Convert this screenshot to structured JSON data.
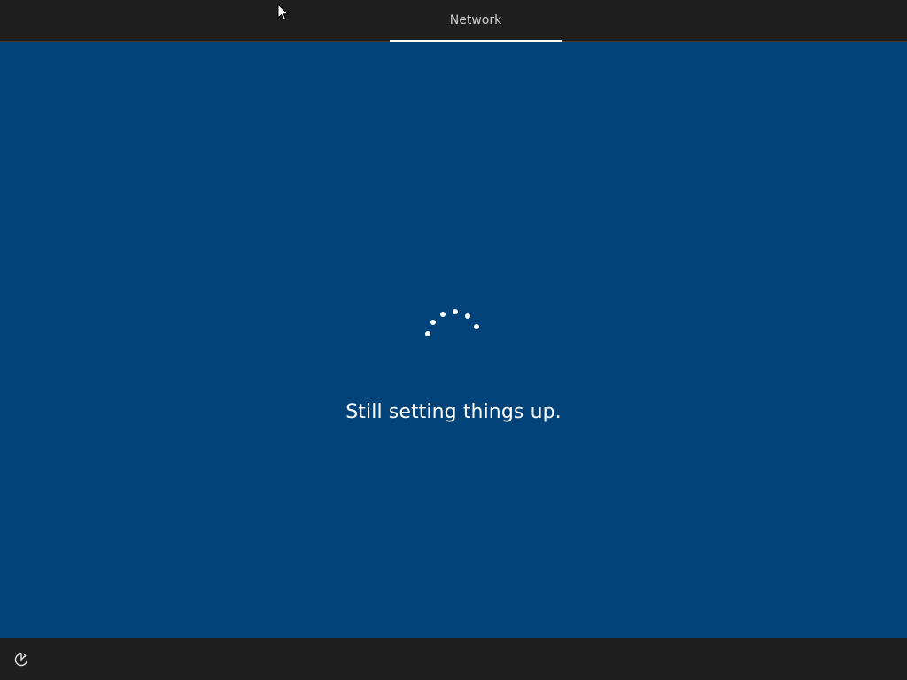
{
  "header": {
    "tab_label": "Network"
  },
  "main": {
    "status_message": "Still setting things up.",
    "background_color": "#02447a"
  },
  "footer": {
    "ease_of_access_icon": "ease-of-access-icon"
  },
  "colors": {
    "bar": "#1f1f1f",
    "accent_underline": "#ffffff",
    "text_primary": "#ffffff",
    "text_tab": "#cfcfcf"
  }
}
